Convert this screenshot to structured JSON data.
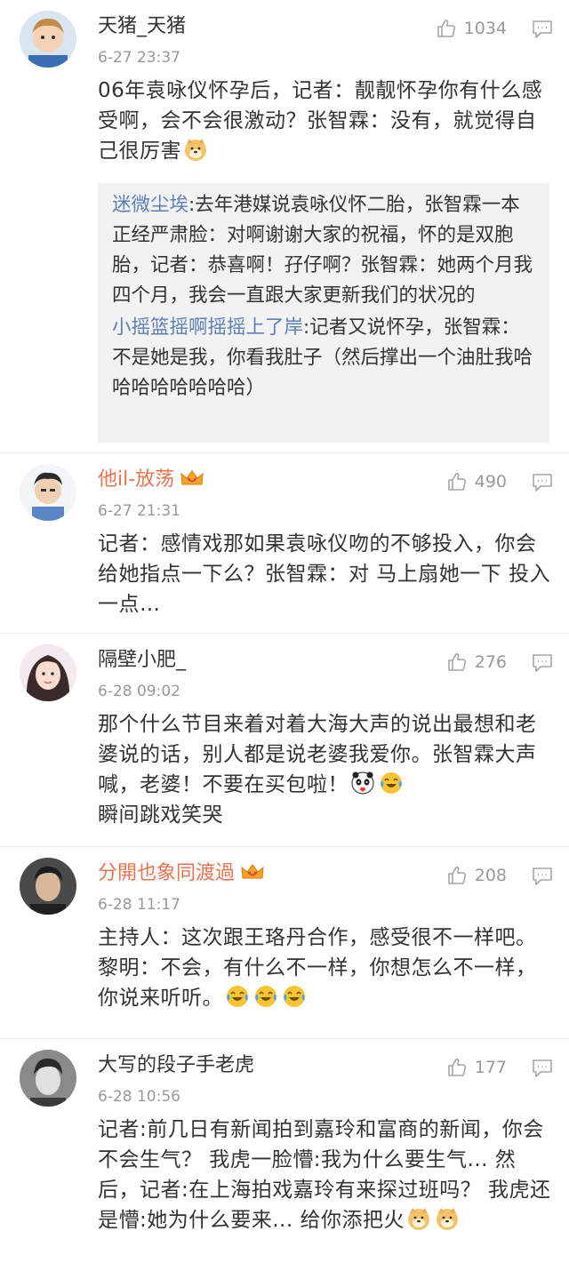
{
  "comments": [
    {
      "username": "天猪_天猪",
      "time": "6-27 23:37",
      "likes": "1034",
      "text": "06年袁咏仪怀孕后，记者：靓靓怀孕你有什么感受啊，会不会很激动？张智霖：没有，就觉得自己很厉害",
      "replies": [
        {
          "name": "迷微尘埃",
          "text": ":去年港媒说袁咏仪怀二胎，张智霖一本正经严肃脸：对啊谢谢大家的祝福，怀的是双胞胎，记者：恭喜啊！孖仔啊？张智霖：她两个月我四个月，我会一直跟大家更新我们的状况的"
        },
        {
          "name": "小摇篮摇啊摇摇上了岸",
          "text": ":记者又说怀孕，张智霖：不是她是我，你看我肚子（然后撑出一个油肚我哈哈哈哈哈哈哈哈）"
        }
      ]
    },
    {
      "username": "他il-放荡",
      "time": "6-27 21:31",
      "likes": "490",
      "text": "记者：感情戏那如果袁咏仪吻的不够投入，你会给她指点一下么？张智霖：对 马上扇她一下 投入一点…"
    },
    {
      "username": "隔壁小肥_",
      "time": "6-28 09:02",
      "likes": "276",
      "text": "那个什么节目来着对着大海大声的说出最想和老婆说的话，别人都是说老婆我爱你。张智霖大声喊，老婆！不要在买包啦！",
      "text2": "瞬间跳戏笑哭"
    },
    {
      "username": "分開也象同渡過",
      "time": "6-28 11:17",
      "likes": "208",
      "text": "主持人：这次跟王珞丹合作，感受很不一样吧。 黎明：不会，有什么不一样，你想怎么不一样，你说来听听。"
    },
    {
      "username": "大写的段子手老虎",
      "time": "6-28 10:56",
      "likes": "177",
      "text": "记者:前几日有新闻拍到嘉玲和富商的新闻，你会不会生气？ 我虎一脸懵:我为什么要生气... 然后，记者:在上海拍戏嘉玲有来探过班吗？ 我虎还是懵:她为什么要来... 给你添把火"
    }
  ]
}
